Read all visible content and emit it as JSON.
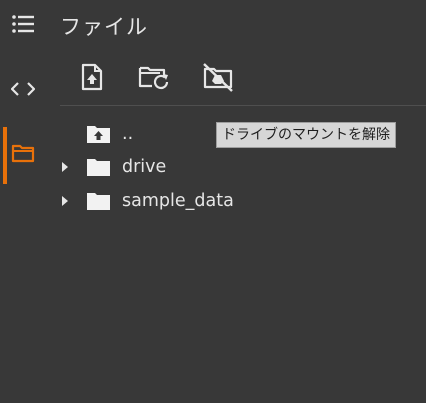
{
  "panel": {
    "title": "ファイル"
  },
  "rail": {
    "items": [
      {
        "icon": "table-of-contents-icon"
      },
      {
        "icon": "code-brackets-icon"
      },
      {
        "icon": "folder-icon",
        "active": true
      }
    ],
    "accent_color": "#e8710a"
  },
  "toolbar": {
    "buttons": [
      {
        "icon": "upload-file-icon"
      },
      {
        "icon": "refresh-folder-icon"
      },
      {
        "icon": "unmount-drive-icon"
      }
    ]
  },
  "tooltip": {
    "text": "ドライブのマウントを解除"
  },
  "tree": {
    "items": [
      {
        "label": "..",
        "type": "parent",
        "icon": "upload-folder-icon"
      },
      {
        "label": "drive",
        "type": "folder",
        "icon": "folder-icon"
      },
      {
        "label": "sample_data",
        "type": "folder",
        "icon": "folder-icon"
      }
    ]
  }
}
